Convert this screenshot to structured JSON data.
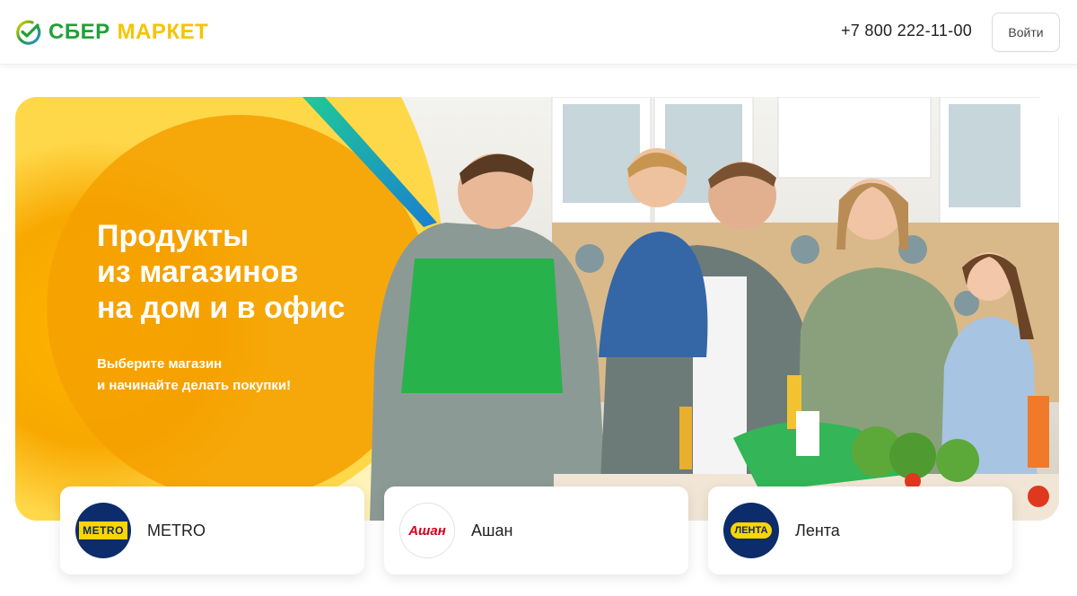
{
  "header": {
    "logo": {
      "part1": "СБЕР",
      "part2": "МАРКЕТ",
      "icon": "sber-check-icon"
    },
    "phone": "+7 800 222-11-00",
    "login_label": "Войти"
  },
  "hero": {
    "title_lines": [
      "Продукты",
      "из магазинов",
      "на дом и в офис"
    ],
    "subtitle_lines": [
      "Выберите магазин",
      "и начинайте делать покупки!"
    ],
    "image": "family-in-kitchen-photo"
  },
  "stores": [
    {
      "name": "METRO",
      "logo_text": "METRO"
    },
    {
      "name": "Ашан",
      "logo_text": "Ашан"
    },
    {
      "name": "Лента",
      "logo_text": "ЛЕНТА"
    }
  ],
  "colors": {
    "sber_green": "#21a038",
    "market_yellow": "#f5c400",
    "hero_orange": "#f6a400",
    "metro_blue": "#0d2c6c",
    "metro_yellow": "#ffd400",
    "auchan_red": "#d6001c"
  }
}
